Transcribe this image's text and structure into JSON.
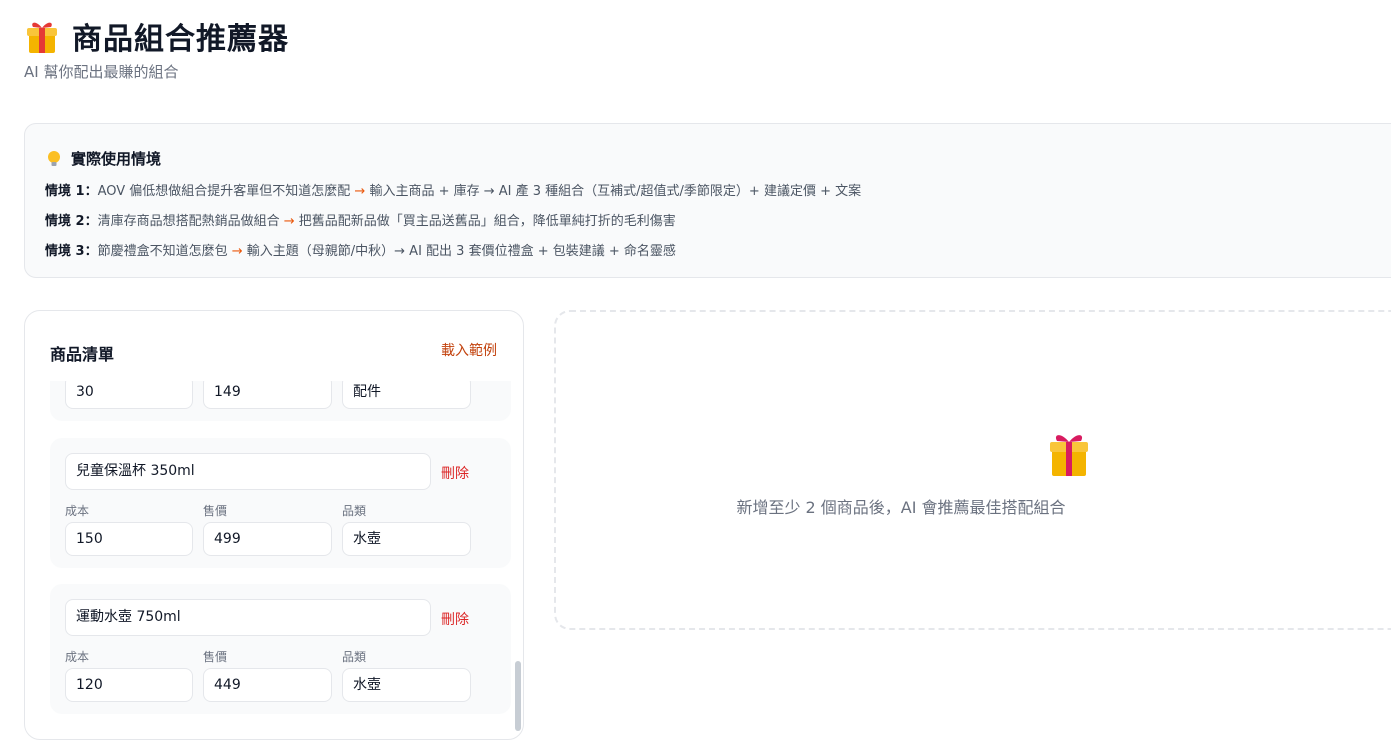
{
  "header": {
    "title": "商品組合推薦器",
    "subtitle": "AI 幫你配出最賺的組合",
    "icon": "gift-icon"
  },
  "use_cases": {
    "heading": "實際使用情境",
    "icon": "lightbulb-icon",
    "items": [
      {
        "label": "情境 1：",
        "problem": "AOV 偏低想做組合提升客單但不知道怎麼配",
        "arrow": " → ",
        "solution": "輸入主商品 + 庫存 → AI 產 3 種組合（互補式/超值式/季節限定）+ 建議定價 + 文案"
      },
      {
        "label": "情境 2：",
        "problem": "清庫存商品想搭配熱銷品做組合",
        "arrow": " → ",
        "solution": "把舊品配新品做「買主品送舊品」組合，降低單純打折的毛利傷害"
      },
      {
        "label": "情境 3：",
        "problem": "節慶禮盒不知道怎麼包",
        "arrow": " → ",
        "solution": "輸入主題（母親節/中秋）→ AI 配出 3 套價位禮盒 + 包裝建議 + 命名靈感"
      }
    ]
  },
  "product_list": {
    "title": "商品清單",
    "load_example": "載入範例",
    "labels": {
      "cost": "成本",
      "price": "售價",
      "category": "品類"
    },
    "delete_label": "刪除",
    "items": [
      {
        "cost": "30",
        "price": "149",
        "category": "配件"
      },
      {
        "name": "兒童保溫杯 350ml",
        "cost": "150",
        "price": "499",
        "category": "水壺"
      },
      {
        "name": "運動水壺 750ml",
        "cost": "120",
        "price": "449",
        "category": "水壺"
      }
    ]
  },
  "result": {
    "empty_message": "新增至少 2 個商品後，AI 會推薦最佳搭配組合",
    "icon": "gift-icon"
  },
  "colors": {
    "accent": "#c2410c",
    "arrow": "#ea580c",
    "delete": "#dc2626",
    "muted": "#6b7280"
  }
}
